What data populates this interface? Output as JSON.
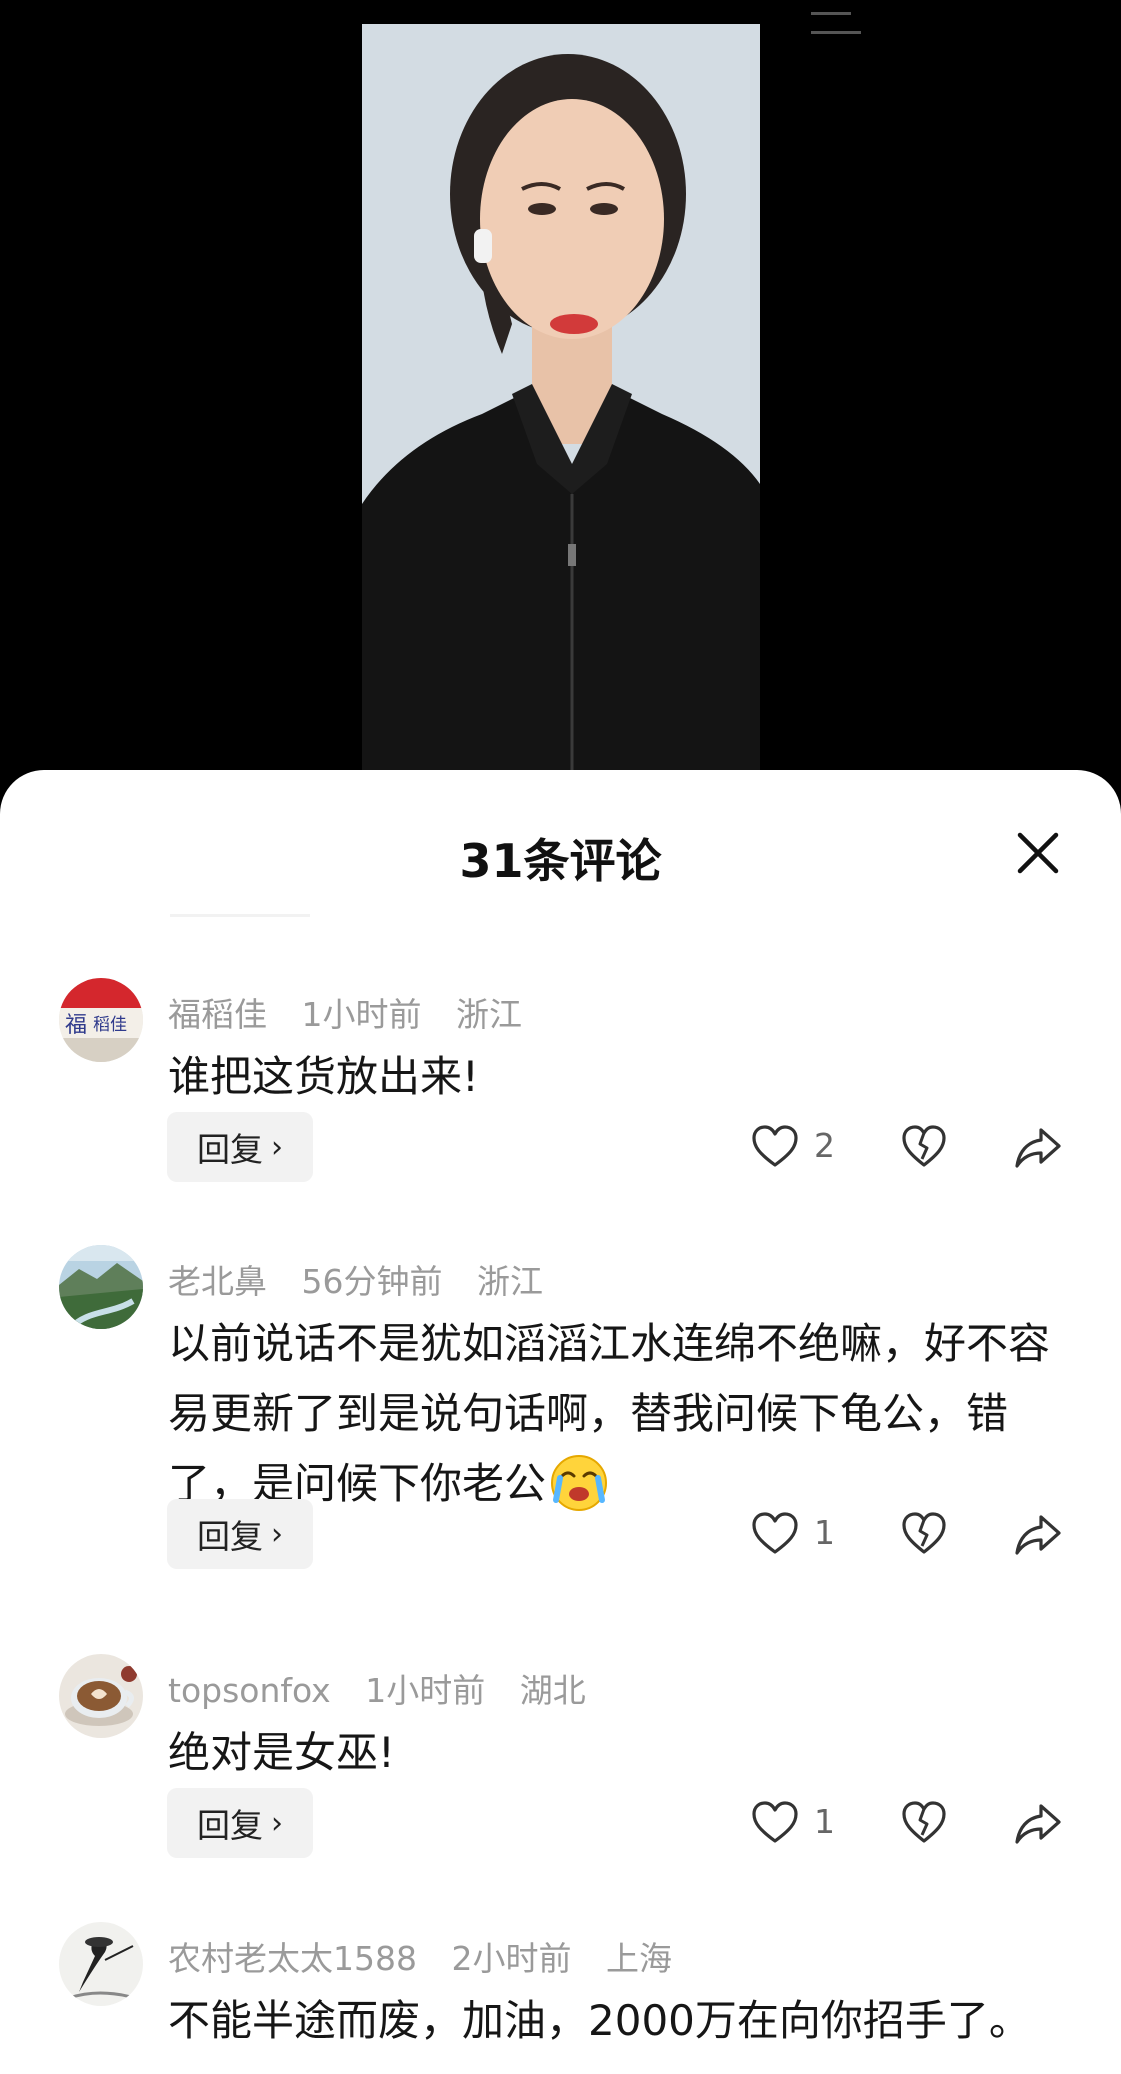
{
  "panel": {
    "title": "31条评论",
    "accent_text": "#161616",
    "meta_color": "#9a9a9a"
  },
  "icons": {
    "close": "close-icon",
    "like": "heart-outline-icon",
    "dislike": "broken-heart-icon",
    "share": "share-arrow-icon",
    "chevron": "chevron-right-icon"
  },
  "comments": [
    {
      "user": "福稻佳",
      "time": "1小时前",
      "location": "浙江",
      "text": "谁把这货放出来!",
      "reply_label": "回复",
      "likes": "2",
      "avatar": "fudaojia-logo-avatar"
    },
    {
      "user": "老北鼻",
      "time": "56分钟前",
      "location": "浙江",
      "text": "以前说话不是犹如滔滔江水连绵不绝嘛，好不容易更新了到是说句话啊，替我问候下龟公，错了，是问候下你老公",
      "emoji": "crying-face-emoji",
      "reply_label": "回复",
      "likes": "1",
      "avatar": "landscape-avatar"
    },
    {
      "user": "topsonfox",
      "time": "1小时前",
      "location": "湖北",
      "text": "绝对是女巫!",
      "reply_label": "回复",
      "likes": "1",
      "avatar": "coffee-cup-avatar"
    },
    {
      "user": "农村老太太1588",
      "time": "2小时前",
      "location": "上海",
      "text": "不能半途而废，加油，2000万在向你招手了。",
      "avatar": "ink-swordsman-avatar"
    }
  ]
}
